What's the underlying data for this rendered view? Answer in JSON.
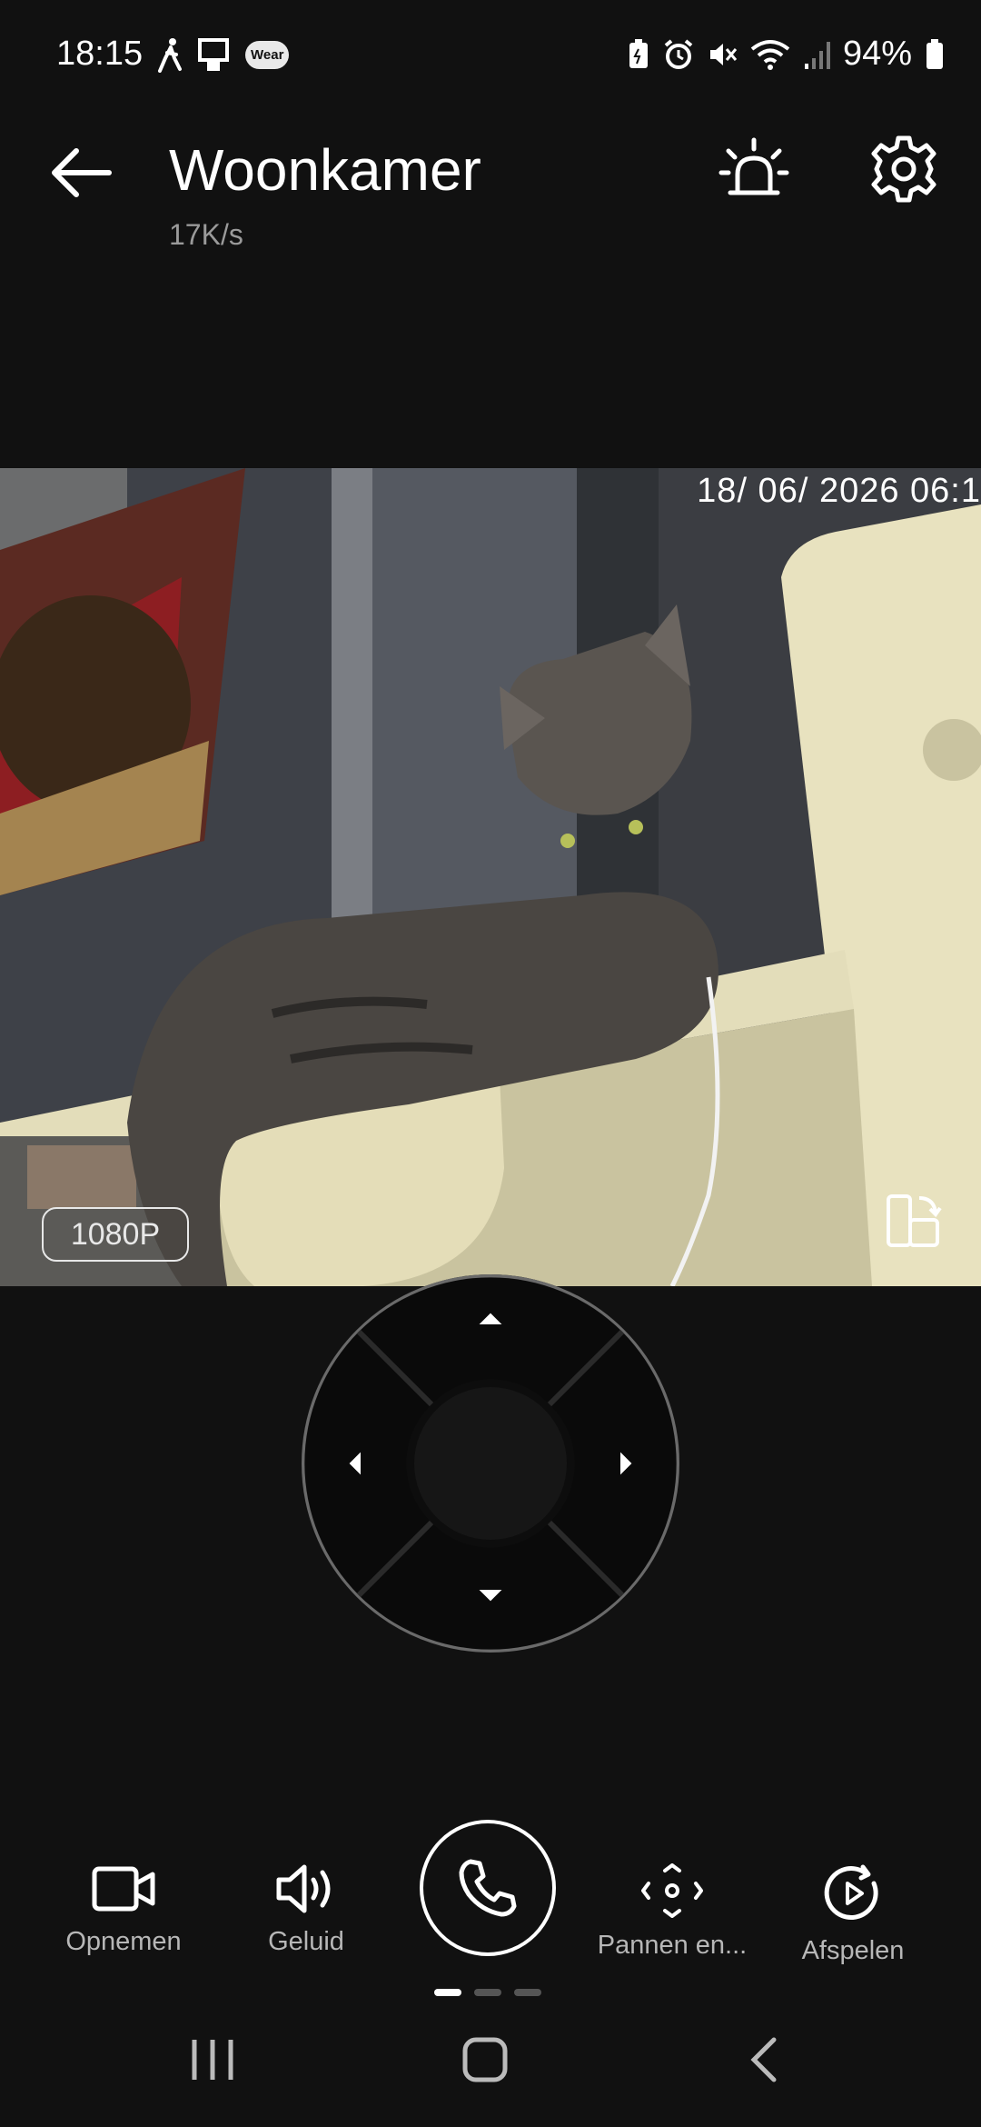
{
  "status_bar": {
    "time": "18:15",
    "wear_badge": "Wear",
    "battery": "94%",
    "icons": [
      "walking-icon",
      "device-icon",
      "wear-icon",
      "battery-saver-icon",
      "alarm-icon",
      "mute-icon",
      "wifi-icon",
      "signal-icon",
      "battery-icon"
    ]
  },
  "header": {
    "title": "Woonkamer",
    "speed": "17K/s",
    "back_icon": "arrow-left-icon",
    "alarm_icon": "siren-icon",
    "settings_icon": "gear-icon"
  },
  "video": {
    "timestamp": "18/ 06/ 2026  06:1",
    "quality": "1080P"
  },
  "dpad": {
    "up": "chevron-up-icon",
    "down": "chevron-down-icon",
    "left": "chevron-left-icon",
    "right": "chevron-right-icon"
  },
  "controls": {
    "record": "Opnemen",
    "sound": "Geluid",
    "pan": "Pannen en...",
    "playback": "Afspelen",
    "call_icon": "phone-icon"
  },
  "colors": {
    "background": "#111111",
    "label": "#b7b7b7",
    "subtitle": "#9a9a9a"
  }
}
